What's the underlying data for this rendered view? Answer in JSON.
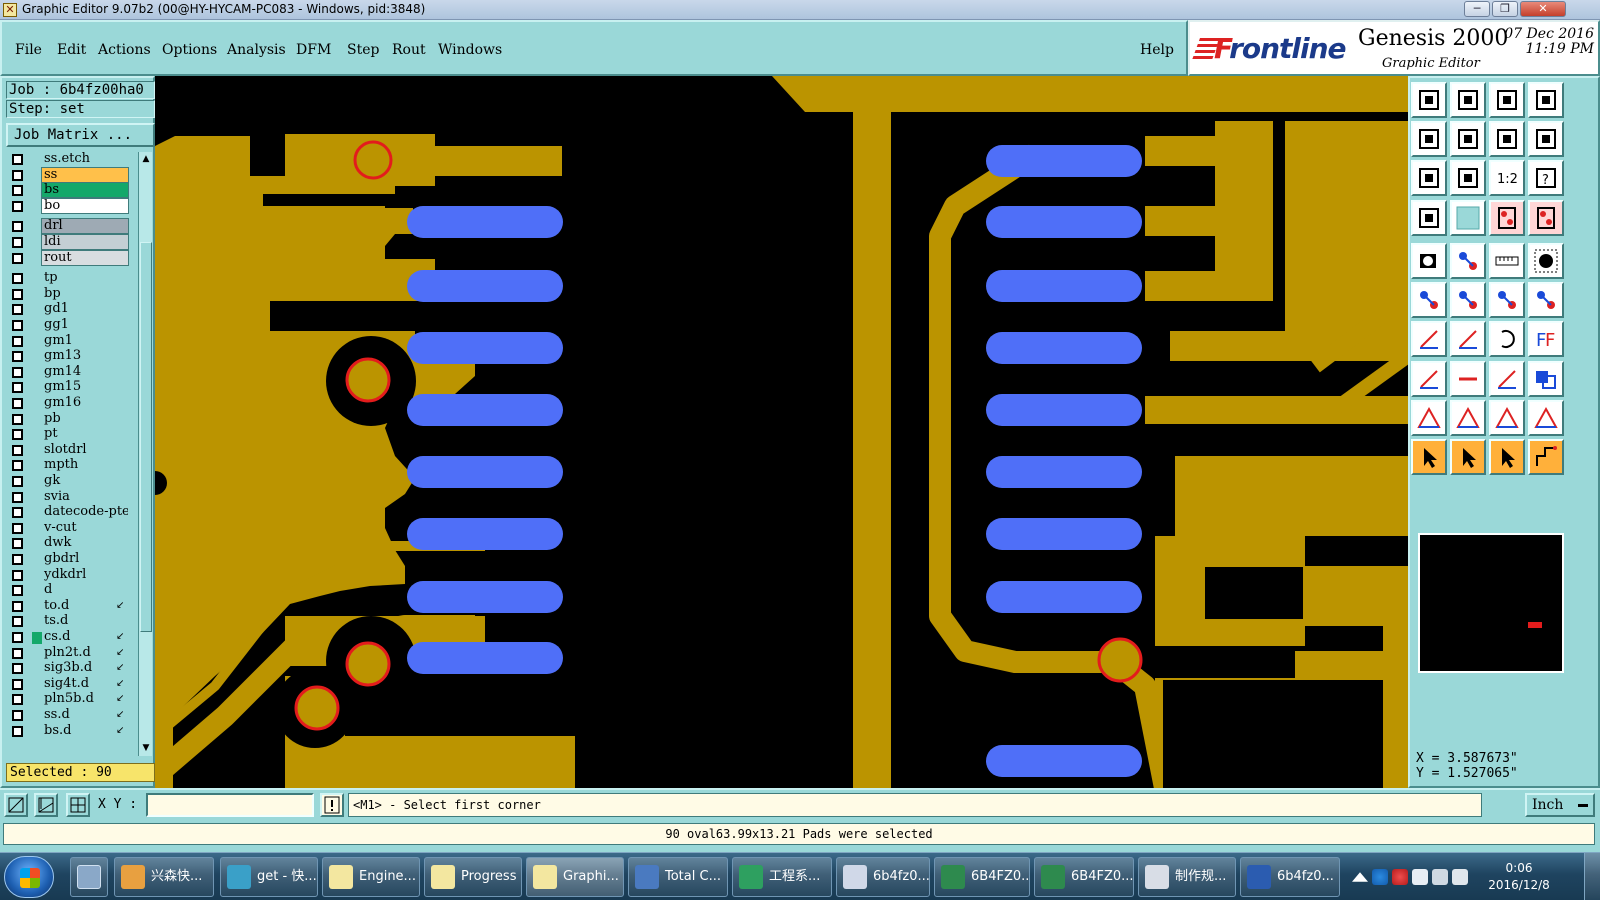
{
  "window": {
    "title": "Graphic Editor 9.07b2 (00@HY-HYCAM-PC083 - Windows, pid:3848)",
    "minimize": "─",
    "maximize": "❐",
    "close": "✕"
  },
  "menu": {
    "items": [
      "File",
      "Edit",
      "Actions",
      "Options",
      "Analysis",
      "DFM",
      "Step",
      "Rout",
      "Windows"
    ],
    "help": "Help"
  },
  "brand": {
    "logo_prefix": "F",
    "logo_rest": "rontline",
    "product": "Genesis 2000",
    "subtitle": "Graphic Editor",
    "date": "07 Dec 2016",
    "time": "11:19 PM"
  },
  "job": {
    "job_label": "Job : 6b4fz00ha0",
    "step_label": "Step: set",
    "matrix_button": "Job Matrix ..."
  },
  "layers": [
    {
      "name": "ss.etch",
      "color": "#9ad8d8",
      "flag": ""
    },
    {
      "name": "ss",
      "color": "#ffc04a",
      "flag": ""
    },
    {
      "name": "bs",
      "color": "#14a86a",
      "flag": ""
    },
    {
      "name": "bo",
      "color": "#ffffff",
      "flag": ""
    },
    {
      "name": "drl",
      "color": "#9eaab4",
      "flag": ""
    },
    {
      "name": "ldi",
      "color": "#c4cfd4",
      "flag": ""
    },
    {
      "name": "rout",
      "color": "#d8dde0",
      "flag": ""
    },
    {
      "name": "tp",
      "color": "#9ad8d8",
      "flag": ""
    },
    {
      "name": "bp",
      "color": "#9ad8d8",
      "flag": ""
    },
    {
      "name": "gd1",
      "color": "#9ad8d8",
      "flag": ""
    },
    {
      "name": "gg1",
      "color": "#9ad8d8",
      "flag": ""
    },
    {
      "name": "gm1",
      "color": "#9ad8d8",
      "flag": ""
    },
    {
      "name": "gm13",
      "color": "#9ad8d8",
      "flag": ""
    },
    {
      "name": "gm14",
      "color": "#9ad8d8",
      "flag": ""
    },
    {
      "name": "gm15",
      "color": "#9ad8d8",
      "flag": ""
    },
    {
      "name": "gm16",
      "color": "#9ad8d8",
      "flag": ""
    },
    {
      "name": "pb",
      "color": "#9ad8d8",
      "flag": ""
    },
    {
      "name": "pt",
      "color": "#9ad8d8",
      "flag": ""
    },
    {
      "name": "slotdrl",
      "color": "#9ad8d8",
      "flag": ""
    },
    {
      "name": "mpth",
      "color": "#9ad8d8",
      "flag": ""
    },
    {
      "name": "gk",
      "color": "#9ad8d8",
      "flag": ""
    },
    {
      "name": "svia",
      "color": "#9ad8d8",
      "flag": ""
    },
    {
      "name": "datecode-pte",
      "color": "#9ad8d8",
      "flag": ""
    },
    {
      "name": "v-cut",
      "color": "#9ad8d8",
      "flag": ""
    },
    {
      "name": "dwk",
      "color": "#9ad8d8",
      "flag": ""
    },
    {
      "name": "gbdrl",
      "color": "#9ad8d8",
      "flag": ""
    },
    {
      "name": "ydkdrl",
      "color": "#9ad8d8",
      "flag": ""
    },
    {
      "name": "d",
      "color": "#9ad8d8",
      "flag": ""
    },
    {
      "name": "to.d",
      "color": "#9ad8d8",
      "flag": "↙"
    },
    {
      "name": "ts.d",
      "color": "#9ad8d8",
      "flag": ""
    },
    {
      "name": "cs.d",
      "color": "#9ad8d8",
      "flag": "↙"
    },
    {
      "name": "pln2t.d",
      "color": "#9ad8d8",
      "flag": "↙"
    },
    {
      "name": "sig3b.d",
      "color": "#9ad8d8",
      "flag": "↙"
    },
    {
      "name": "sig4t.d",
      "color": "#9ad8d8",
      "flag": "↙"
    },
    {
      "name": "pln5b.d",
      "color": "#9ad8d8",
      "flag": "↙"
    },
    {
      "name": "ss.d",
      "color": "#9ad8d8",
      "flag": "↙"
    },
    {
      "name": "bs.d",
      "color": "#9ad8d8",
      "flag": "↙"
    }
  ],
  "selected": "Selected : 90",
  "coords": {
    "x": "X = 3.587673\"",
    "y": "Y = 1.527065\""
  },
  "cmd": {
    "xy_label": "X Y :",
    "xy_value": "",
    "prompt": "<M1> - Select first corner",
    "unit": "Inch"
  },
  "status": "90 oval63.99x13.21 Pads were selected",
  "colors": {
    "copper": "#bb9400",
    "pad_blue": "#4f6ff8",
    "ring_red": "#e31c1c",
    "panel": "#9ad8d8"
  },
  "tools": [
    "zoom-home-icon",
    "zoom-down-icon",
    "home-icon",
    "panel-icon",
    "pan-left-icon",
    "pan-right-icon",
    "undo-view-icon",
    "redo-view-icon",
    "fit-icon",
    "zoom-all-icon",
    "scale-icon",
    "help-icon",
    "hand-icon",
    "grid-icon",
    "snap-icon",
    "snap2-icon",
    "circle-pad-icon",
    "rect-pad-icon",
    "ruler-icon",
    "filled-pad-icon",
    "node-icon",
    "cross-icon",
    "dot-icon",
    "dot2-icon",
    "line-icon",
    "diag-icon",
    "arc-icon",
    "text-icon",
    "square-pad-icon",
    "minus-icon",
    "measure-icon",
    "copy-icon",
    "triangle-icon",
    "triangle2-icon",
    "triangle3-icon",
    "triangle4-icon",
    "select-icon",
    "select2-icon",
    "select3-icon",
    "route-icon"
  ],
  "taskbar": {
    "items": [
      "兴森快...",
      "get - 快...",
      "Engine...",
      "Progress",
      "Graphi...",
      "Total C...",
      "工程系...",
      "6b4fz0...",
      "6B4FZ0...",
      "6B4FZ0...",
      "制作规...",
      "6b4fz0..."
    ],
    "time": "0:06",
    "date": "2016/12/8"
  }
}
